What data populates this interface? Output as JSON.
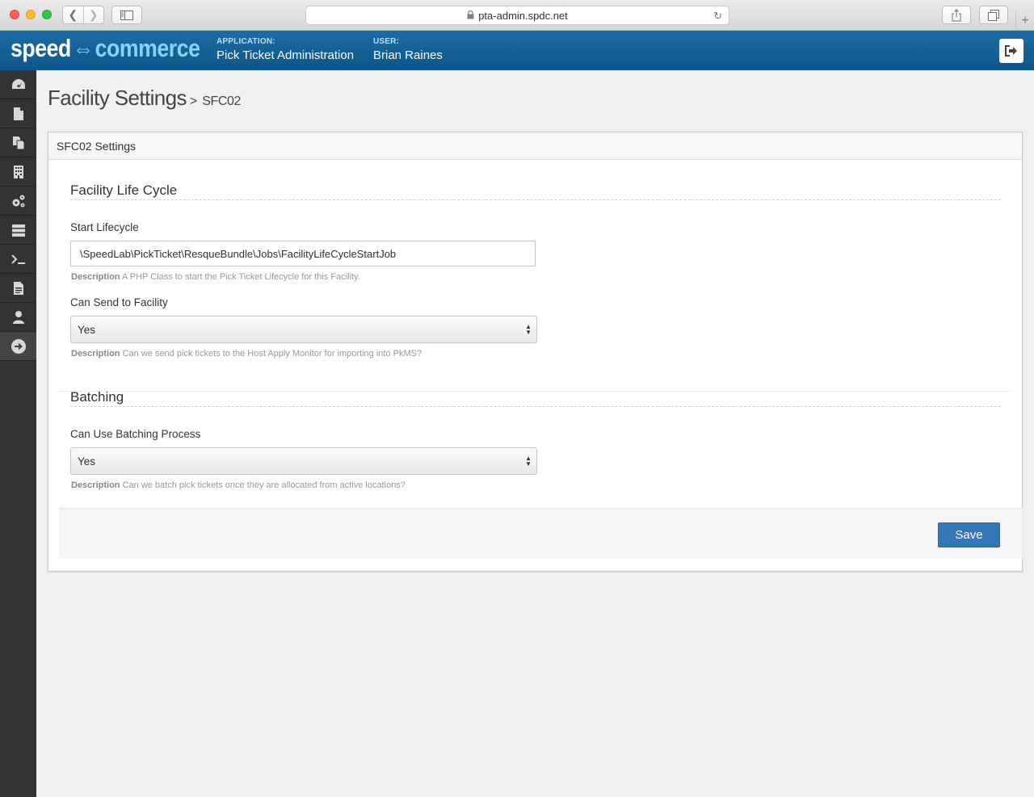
{
  "browser": {
    "url": "pta-admin.spdc.net"
  },
  "brand": {
    "name_part1": "speed",
    "name_part2": "commerce",
    "primary_color": "#15639b",
    "accent_color": "#88d3f4"
  },
  "header": {
    "application_label": "APPLICATION:",
    "application_value": "Pick Ticket Administration",
    "user_label": "USER:",
    "user_value": "Brian Raines"
  },
  "sidenav": {
    "items": [
      {
        "icon": "dashboard-icon"
      },
      {
        "icon": "file-icon"
      },
      {
        "icon": "copy-icon"
      },
      {
        "icon": "building-icon"
      },
      {
        "icon": "gears-icon"
      },
      {
        "icon": "server-icon"
      },
      {
        "icon": "terminal-icon"
      },
      {
        "icon": "document-icon"
      },
      {
        "icon": "user-icon"
      },
      {
        "icon": "arrow-circle-icon"
      }
    ]
  },
  "page": {
    "title": "Facility Settings",
    "separator": ">",
    "crumb": "SFC02"
  },
  "panel": {
    "heading": "SFC02 Settings",
    "sections": [
      {
        "title": "Facility Life Cycle",
        "fields": [
          {
            "label": "Start Lifecycle",
            "value": "\\SpeedLab\\PickTicket\\ResqueBundle\\Jobs\\FacilityLifeCycleStartJob",
            "help_label": "Description",
            "help_text": "A PHP Class to start the Pick Ticket Lifecycle for this Facility."
          },
          {
            "label": "Can Send to Facility",
            "value": "Yes",
            "help_label": "Description",
            "help_text": "Can we send pick tickets to the Host Apply Monitor for importing into PkMS?"
          }
        ]
      },
      {
        "title": "Batching",
        "fields": [
          {
            "label": "Can Use Batching Process",
            "value": "Yes",
            "help_label": "Description",
            "help_text": "Can we batch pick tickets once they are allocated from active locations?"
          }
        ]
      }
    ],
    "save_label": "Save"
  }
}
